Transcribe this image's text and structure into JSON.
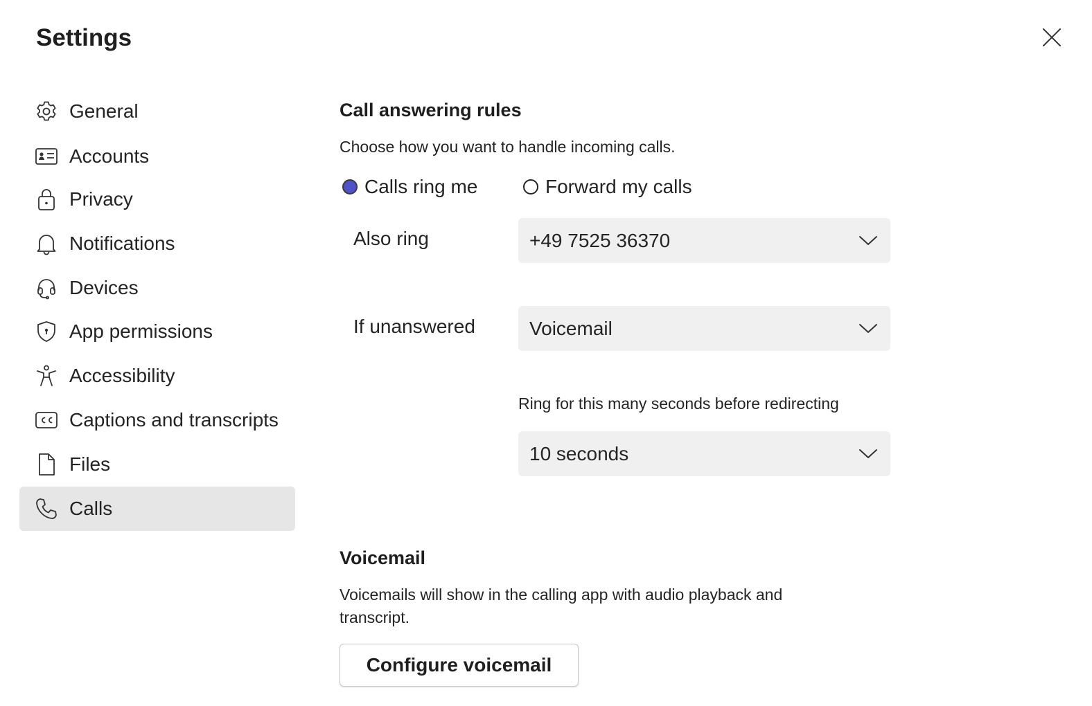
{
  "header": {
    "title": "Settings",
    "close_icon": "close-icon"
  },
  "sidebar": {
    "items": [
      {
        "label": "General",
        "icon": "gear-icon",
        "active": false
      },
      {
        "label": "Accounts",
        "icon": "id-card-icon",
        "active": false
      },
      {
        "label": "Privacy",
        "icon": "lock-icon",
        "active": false
      },
      {
        "label": "Notifications",
        "icon": "bell-icon",
        "active": false
      },
      {
        "label": "Devices",
        "icon": "headset-icon",
        "active": false
      },
      {
        "label": "App permissions",
        "icon": "shield-icon",
        "active": false
      },
      {
        "label": "Accessibility",
        "icon": "accessibility-icon",
        "active": false
      },
      {
        "label": "Captions and transcripts",
        "icon": "cc-icon",
        "active": false
      },
      {
        "label": "Files",
        "icon": "file-icon",
        "active": false
      },
      {
        "label": "Calls",
        "icon": "phone-icon",
        "active": true
      }
    ]
  },
  "call_answering": {
    "heading": "Call answering rules",
    "description": "Choose how you want to handle incoming calls.",
    "options": [
      {
        "label": "Calls ring me",
        "checked": true
      },
      {
        "label": "Forward my calls",
        "checked": false
      }
    ],
    "also_ring": {
      "label": "Also ring",
      "value": "+49 7525 36370"
    },
    "if_unanswered": {
      "label": "If unanswered",
      "value": "Voicemail"
    },
    "ring_seconds": {
      "label": "Ring for this many seconds before redirecting",
      "value": "10 seconds"
    }
  },
  "voicemail": {
    "heading": "Voicemail",
    "description": "Voicemails will show in the calling app with audio playback and transcript.",
    "button_label": "Configure voicemail"
  },
  "colors": {
    "accent": "#4f52c8",
    "active_item_bg": "#e6e6e6",
    "dropdown_bg": "#f0f0f0"
  }
}
